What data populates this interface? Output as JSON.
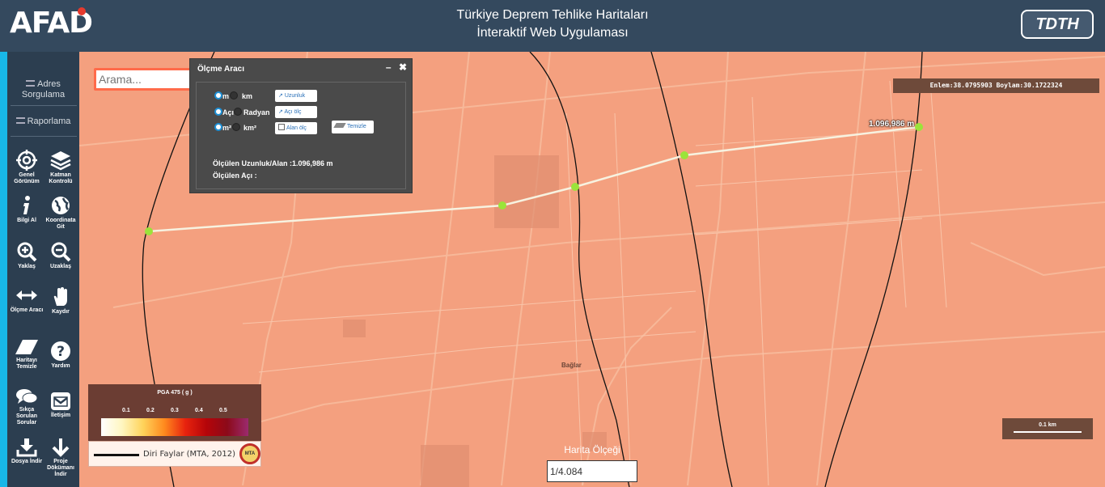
{
  "header": {
    "logo": "AFAD",
    "title_line1": "Türkiye Deprem Tehlike Haritaları",
    "title_line2": "İnteraktif Web Uygulaması",
    "right_logo": "TDTH"
  },
  "sidebar": {
    "address_query": "Adres Sorgulama",
    "reporting": "Raporlama",
    "tools": [
      {
        "label": "Genel Görünüm",
        "icon": "crosshair-icon"
      },
      {
        "label": "Katman Kontrolü",
        "icon": "layers-icon"
      },
      {
        "label": "Bilgi Al",
        "icon": "info-icon"
      },
      {
        "label": "Koordinata Git",
        "icon": "globe-icon"
      },
      {
        "label": "Yaklaş",
        "icon": "zoom-in-icon"
      },
      {
        "label": "Uzaklaş",
        "icon": "zoom-out-icon"
      },
      {
        "label": "Ölçme Aracı",
        "icon": "measure-arrows-icon"
      },
      {
        "label": "Kaydır",
        "icon": "hand-icon"
      },
      {
        "label": "Haritayı Temizle",
        "icon": "eraser-icon"
      },
      {
        "label": "Yardım",
        "icon": "help-icon"
      },
      {
        "label": "Sıkça Sorulan Sorular",
        "icon": "chat-icon"
      },
      {
        "label": "İletişim",
        "icon": "mail-icon"
      },
      {
        "label": "Dosya İndir",
        "icon": "download-icon"
      },
      {
        "label": "Proje Dökümanı İndir",
        "icon": "download-arrow-icon"
      }
    ]
  },
  "search": {
    "placeholder": "Arama..."
  },
  "measure_panel": {
    "title": "Ölçme Aracı",
    "minimize": "–",
    "close": "✖",
    "unit_m": "m",
    "unit_km": "km",
    "angle_deg": "Açı",
    "angle_rad": "Radyan",
    "area_m2": "m²",
    "area_km2": "km²",
    "btn_length": "Uzunluk",
    "btn_angle": "Açı ölç",
    "btn_area": "Alan ölç",
    "btn_clear": "Temizle",
    "result_length": "Ölçülen Uzunluk/Alan :1.096,986 m",
    "result_angle": "Ölçülen Açı :"
  },
  "coords": "Enlem:38.0795903  Boylam:30.1722324",
  "distance_label": "1.096,986 m",
  "place_label": "Bağlar",
  "legend": {
    "title": "PGA 475 ( g )",
    "ticks": [
      "0.1",
      "0.2",
      "0.3",
      "0.4",
      "0.5"
    ],
    "fault_label": "Diri Faylar (MTA, 2012)",
    "mta": "MTA"
  },
  "scale": {
    "label": "Harita Ölçeği",
    "value": "1/4.084",
    "bar_label": "0.1 km"
  }
}
